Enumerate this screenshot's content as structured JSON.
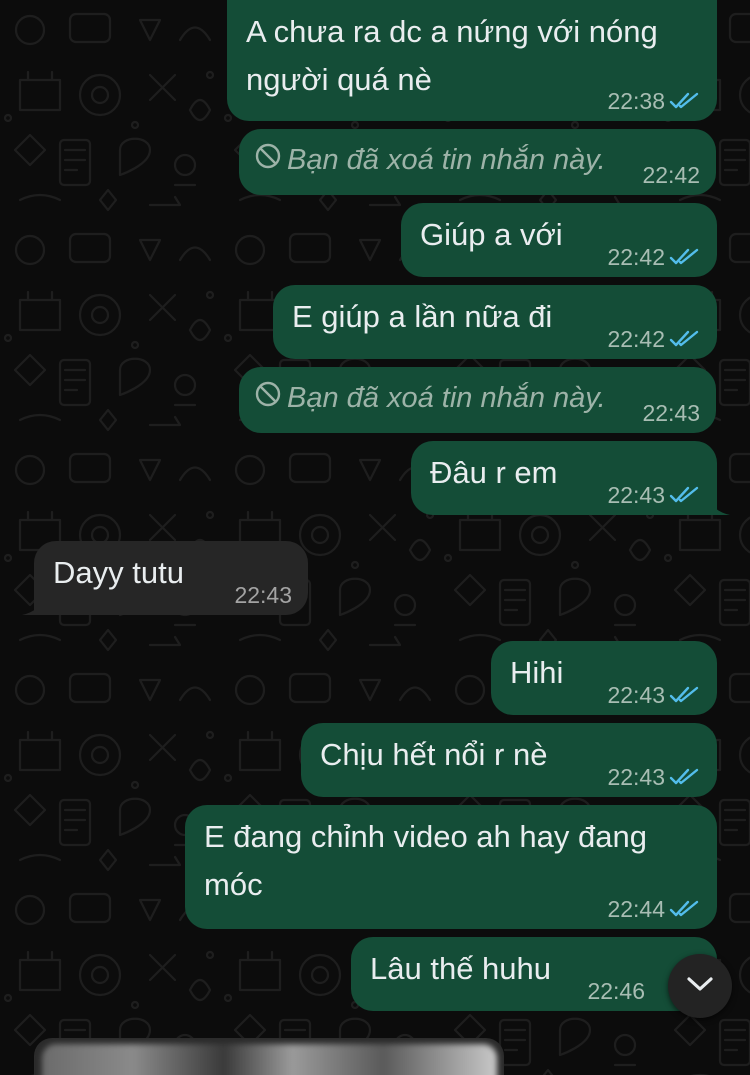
{
  "chat": {
    "messages": [
      {
        "direction": "out",
        "text": "A chưa ra dc a nứng với nóng người quá nè",
        "time": "22:38",
        "status": "read"
      },
      {
        "direction": "out",
        "deleted": true,
        "text": "Bạn đã xoá tin nhắn này.",
        "time": "22:42"
      },
      {
        "direction": "out",
        "text": "Giúp a với",
        "time": "22:42",
        "status": "read"
      },
      {
        "direction": "out",
        "text": "E giúp a lần nữa đi",
        "time": "22:42",
        "status": "read"
      },
      {
        "direction": "out",
        "deleted": true,
        "text": "Bạn đã xoá tin nhắn này.",
        "time": "22:43"
      },
      {
        "direction": "out",
        "text": "Đâu r em",
        "time": "22:43",
        "status": "read"
      },
      {
        "direction": "in",
        "text": "Dayy tutu",
        "time": "22:43"
      },
      {
        "direction": "out",
        "text": "Hihi",
        "time": "22:43",
        "status": "read"
      },
      {
        "direction": "out",
        "text": "Chịu hết nổi r nè",
        "time": "22:43",
        "status": "read"
      },
      {
        "direction": "out",
        "text": "E đang chỉnh video ah hay đang móc",
        "time": "22:44",
        "status": "read"
      },
      {
        "direction": "out",
        "text": "Lâu thế huhu",
        "time": "22:46",
        "status": "read"
      }
    ]
  },
  "icons": {
    "read_receipt": "double-check-icon",
    "deleted": "prohibited-icon",
    "scroll_down": "chevron-down-icon"
  },
  "colors": {
    "outgoing_bubble": "#144d37",
    "incoming_bubble": "#262626",
    "read_tick": "#53bdeb",
    "background": "#0c0c0c"
  }
}
